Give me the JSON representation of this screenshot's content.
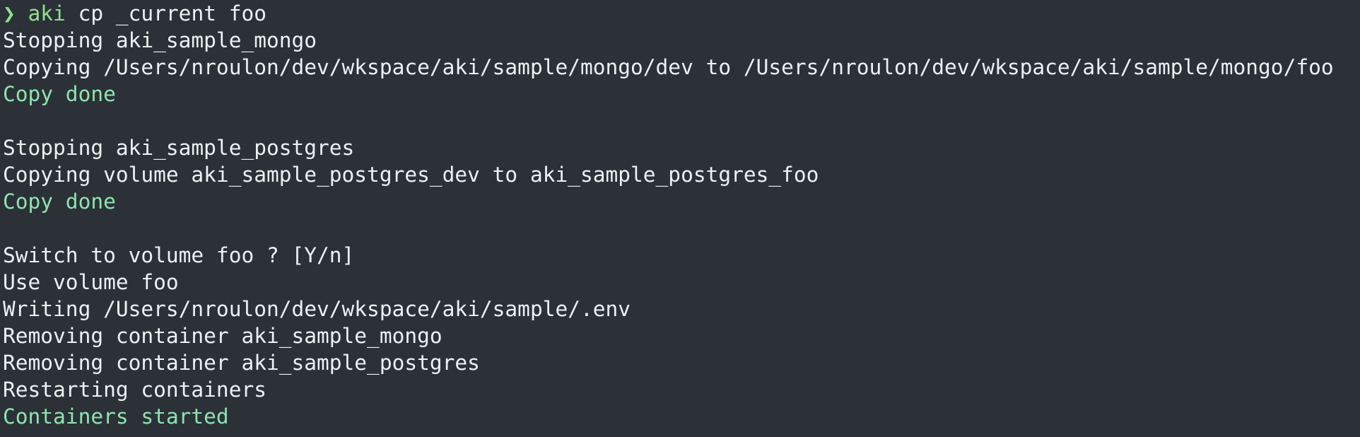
{
  "terminal": {
    "prompt": {
      "symbol": "❯",
      "command": "aki",
      "args": "cp _current foo"
    },
    "lines": [
      {
        "text": "Stopping aki_sample_mongo",
        "style": "normal"
      },
      {
        "text": "Copying /Users/nroulon/dev/wkspace/aki/sample/mongo/dev to /Users/nroulon/dev/wkspace/aki/sample/mongo/foo",
        "style": "normal"
      },
      {
        "text": "Copy done",
        "style": "success"
      },
      {
        "text": "",
        "style": "normal"
      },
      {
        "text": "Stopping aki_sample_postgres",
        "style": "normal"
      },
      {
        "text": "Copying volume aki_sample_postgres_dev to aki_sample_postgres_foo",
        "style": "normal"
      },
      {
        "text": "Copy done",
        "style": "success"
      },
      {
        "text": "",
        "style": "normal"
      },
      {
        "text": "Switch to volume foo ? [Y/n]",
        "style": "normal"
      },
      {
        "text": "Use volume foo",
        "style": "normal"
      },
      {
        "text": "Writing /Users/nroulon/dev/wkspace/aki/sample/.env",
        "style": "normal"
      },
      {
        "text": "Removing container aki_sample_mongo",
        "style": "normal"
      },
      {
        "text": "Removing container aki_sample_postgres",
        "style": "normal"
      },
      {
        "text": "Restarting containers",
        "style": "normal"
      },
      {
        "text": "Containers started",
        "style": "success"
      }
    ],
    "colors": {
      "background": "#2b3137",
      "foreground": "#eef1f2",
      "prompt": "#8fe08d",
      "success": "#8fe3b0"
    }
  }
}
